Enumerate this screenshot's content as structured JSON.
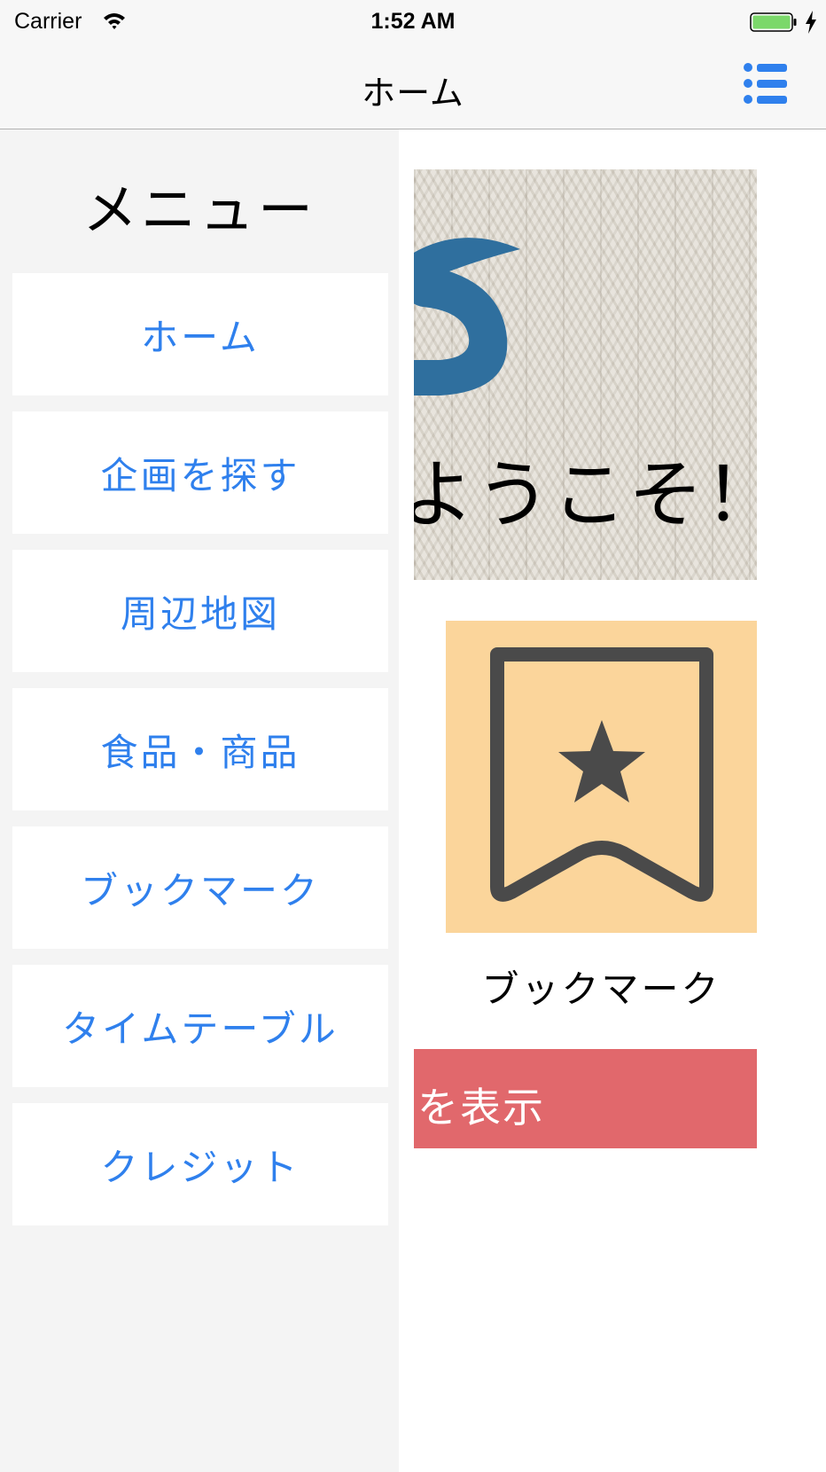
{
  "status_bar": {
    "carrier": "Carrier",
    "time": "1:52 AM"
  },
  "nav_bar": {
    "title": "ホーム",
    "menu_icon": "list-icon"
  },
  "side_menu": {
    "title": "メニュー",
    "items": [
      {
        "label": "ホーム"
      },
      {
        "label": "企画を探す"
      },
      {
        "label": "周辺地図"
      },
      {
        "label": "食品・商品"
      },
      {
        "label": "ブックマーク"
      },
      {
        "label": "タイムテーブル"
      },
      {
        "label": "クレジット"
      }
    ]
  },
  "main": {
    "banner": {
      "welcome_text": "ようこそ！"
    },
    "bookmark_tile": {
      "icon": "bookmark-star-icon",
      "caption": "ブックマーク"
    },
    "show_button": {
      "label": "を表示"
    }
  },
  "colors": {
    "accent_blue": "#2f80ed",
    "bookmark_tile_bg": "#fbd59b",
    "show_button_bg": "#e1686c",
    "logo_blue": "#2f6f9e",
    "icon_gray": "#4a4a4a",
    "battery_green": "#7bd86a"
  }
}
